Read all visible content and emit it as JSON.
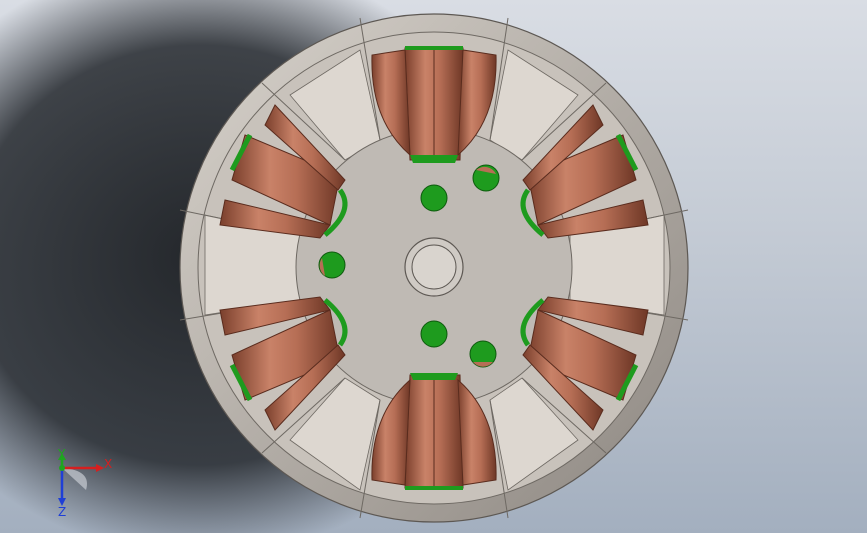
{
  "viewport": {
    "background_top": "#d9dde4",
    "background_bottom": "#a3afbf",
    "shadow_color": "#1c1f23"
  },
  "model": {
    "housing_color": "#c9c4bd",
    "housing_dark": "#7f7a74",
    "face_color": "#c3bdb6",
    "slot_light": "#dcd6cf",
    "winding_color": "#b66e55",
    "winding_dark": "#7a3f2c",
    "insulation_color": "#1e9b1e",
    "hub_color": "#bfbab4"
  },
  "triad": {
    "x_label": "X",
    "y_label": "Y",
    "z_label": "Z",
    "x_color": "#d61f1f",
    "y_color": "#1fa51f",
    "z_color": "#1f3fd6"
  }
}
